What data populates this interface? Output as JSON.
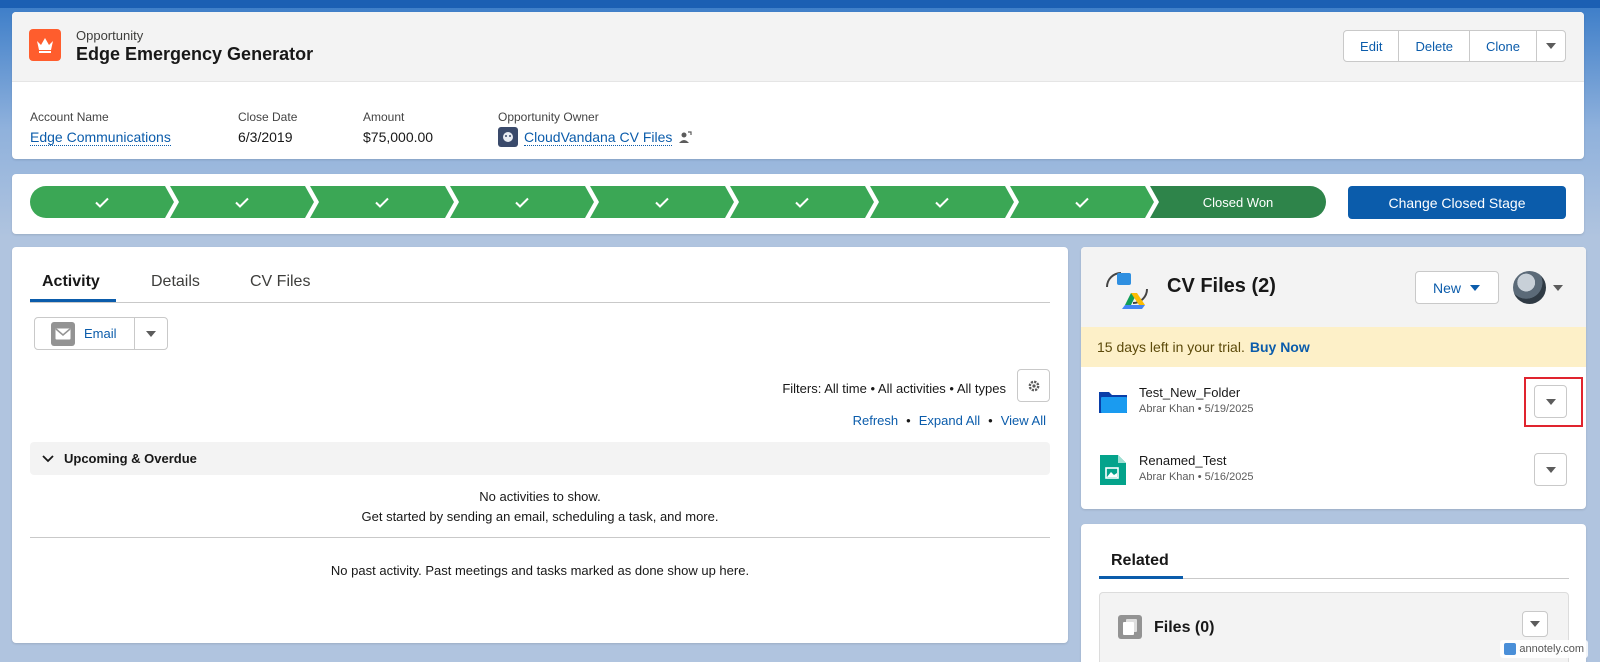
{
  "header": {
    "object_type": "Opportunity",
    "record_name": "Edge Emergency Generator",
    "actions": [
      "Edit",
      "Delete",
      "Clone"
    ],
    "fields": {
      "account_label": "Account Name",
      "account_value": "Edge Communications",
      "close_label": "Close Date",
      "close_value": "6/3/2019",
      "amount_label": "Amount",
      "amount_value": "$75,000.00",
      "owner_label": "Opportunity Owner",
      "owner_value": "CloudVandana CV Files"
    }
  },
  "path": {
    "completed_steps": 8,
    "final_stage": "Closed Won",
    "change_button": "Change Closed Stage",
    "colors": {
      "complete": "#3ba755",
      "final": "#2e844a"
    }
  },
  "activity": {
    "tabs": [
      "Activity",
      "Details",
      "CV Files"
    ],
    "email_button": "Email",
    "filters": "Filters: All time • All activities • All types",
    "links": [
      "Refresh",
      "Expand All",
      "View All"
    ],
    "section_title": "Upcoming & Overdue",
    "no_activities": "No activities to show.",
    "get_started": "Get started by sending an email, scheduling a task, and more.",
    "no_past": "No past activity. Past meetings and tasks marked as done show up here."
  },
  "cv_files": {
    "title": "CV Files (2)",
    "new_button": "New",
    "trial_text": "15 days left in your trial.",
    "buy_now": "Buy Now",
    "files": [
      {
        "name": "Test_New_Folder",
        "meta": "Abrar Khan • 5/19/2025",
        "icon": "folder-icon"
      },
      {
        "name": "Renamed_Test",
        "meta": "Abrar Khan • 5/16/2025",
        "icon": "image-file-icon"
      }
    ]
  },
  "related": {
    "tab": "Related",
    "files_title": "Files (0)"
  },
  "watermark": "annotely.com",
  "colors": {
    "brand_blue": "#0b5cab",
    "opportunity_orange": "#ff5d2d",
    "highlight_red": "#e0242e",
    "trial_bg": "#fdf0c8"
  }
}
